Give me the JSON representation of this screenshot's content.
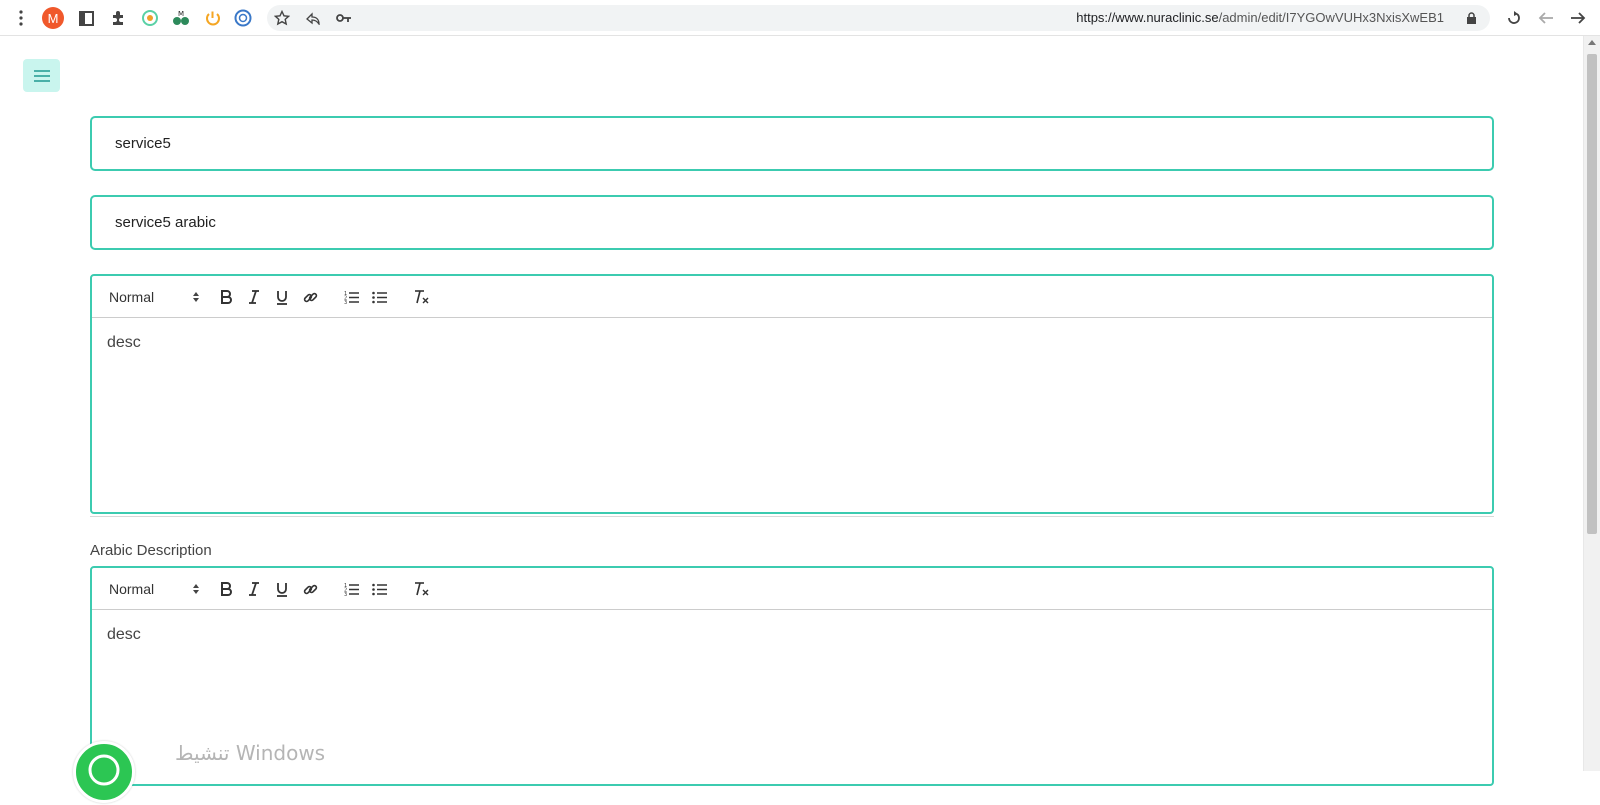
{
  "browser": {
    "profile_initial": "M",
    "url_host": "https://www.nuraclinic.se",
    "url_path": "/admin/edit/I7YGOwVUHx3NxisXwEB1",
    "icons": [
      "more-vert-icon",
      "profile-avatar",
      "sidebar-icon",
      "extensions-icon",
      "extension-target-icon",
      "extension-m-icon",
      "power-icon",
      "extension-circle-icon",
      "star-icon",
      "share-icon",
      "key-icon",
      "lock-icon",
      "reload-icon",
      "back-icon",
      "forward-icon"
    ]
  },
  "form": {
    "name_value": "service5",
    "arabic_name_value": "service5 arabic",
    "description": {
      "format_label": "Normal",
      "content": "desc"
    },
    "arabic_description": {
      "label": "Arabic Description",
      "format_label": "Normal",
      "content": "desc"
    }
  },
  "overlay": {
    "activate_windows": "تنشيط Windows"
  },
  "colors": {
    "accent": "#3ccbb0",
    "menu_button_bg": "#c9f5ee",
    "profile_avatar": "#f0582b",
    "whatsapp": "#2cc653"
  }
}
